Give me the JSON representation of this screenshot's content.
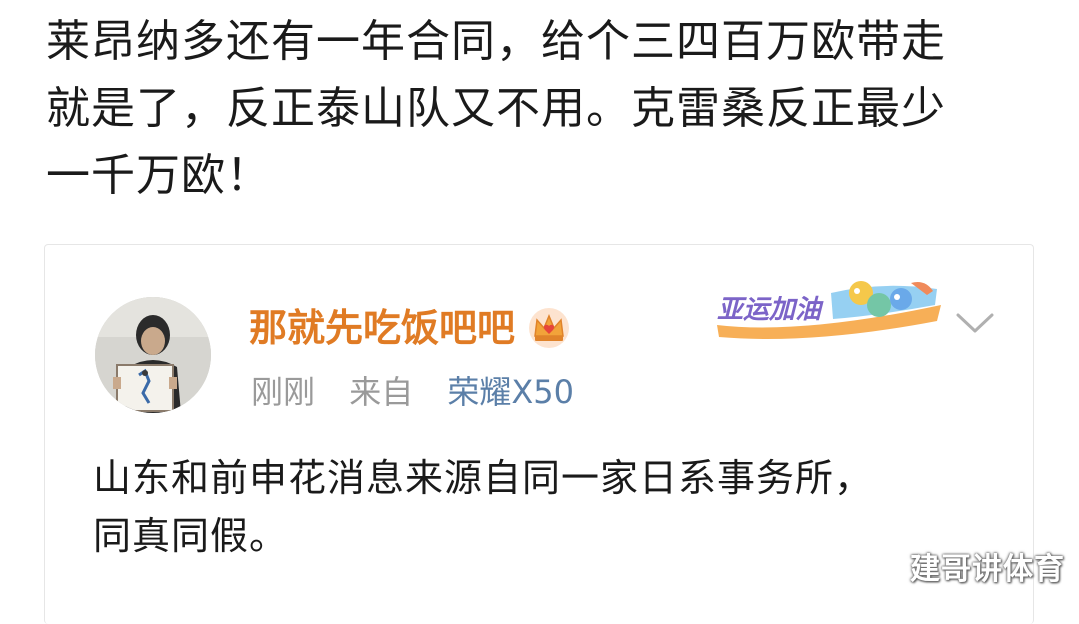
{
  "headline": {
    "line1": "莱昂纳多还有一年合同，给个三四百万欧带走",
    "line2": "就是了，反正泰山队又不用。克雷桑反正最少",
    "line3": "一千万欧！"
  },
  "quoted_post": {
    "avatar_icon": "user-avatar-photo",
    "username": "那就先吃饭吧吧",
    "crown_icon": "crown-icon",
    "time": "刚刚",
    "from_label": "来自",
    "device": "荣耀X50",
    "badge_text": "亚运加油",
    "badge_icon": "asian-games-badge",
    "menu_icon": "chevron-down-icon",
    "text_line1": "山东和前申花消息来源自同一家日系事务所，",
    "text_line2": "同真同假。",
    "username_color": "#e07b24",
    "device_color": "#5b7fa8"
  },
  "watermark": "建哥讲体育"
}
